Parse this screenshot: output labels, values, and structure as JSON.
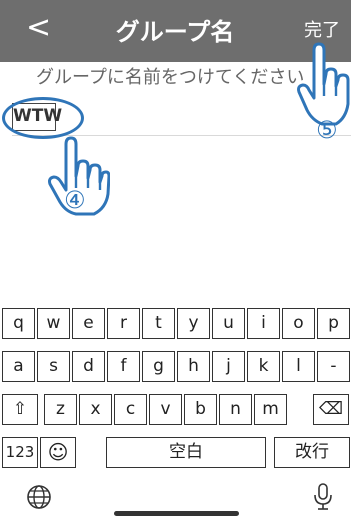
{
  "navbar": {
    "back_label": "<",
    "title": "グループ名",
    "done_label": "完了"
  },
  "name_prompt": "グループに名前をつけてください",
  "name_input": {
    "value": "WTW"
  },
  "steps": {
    "step4": "④",
    "step5": "⑤"
  },
  "colors": {
    "navbar": "#6e6e6e",
    "accent": "#2f75b8"
  },
  "keyboard": {
    "row1": [
      "q",
      "w",
      "e",
      "r",
      "t",
      "y",
      "u",
      "i",
      "o",
      "p"
    ],
    "row2": [
      "a",
      "s",
      "d",
      "f",
      "g",
      "h",
      "j",
      "k",
      "l",
      "-"
    ],
    "row3": [
      "z",
      "x",
      "c",
      "v",
      "b",
      "n",
      "m"
    ],
    "shift_icon": "⇧",
    "delete_icon": "⌫",
    "numbers_label": "123",
    "emoji_icon": "☺",
    "space_label": "空白",
    "return_label": "改行",
    "globe_icon": "globe-icon",
    "mic_icon": "microphone-icon"
  }
}
